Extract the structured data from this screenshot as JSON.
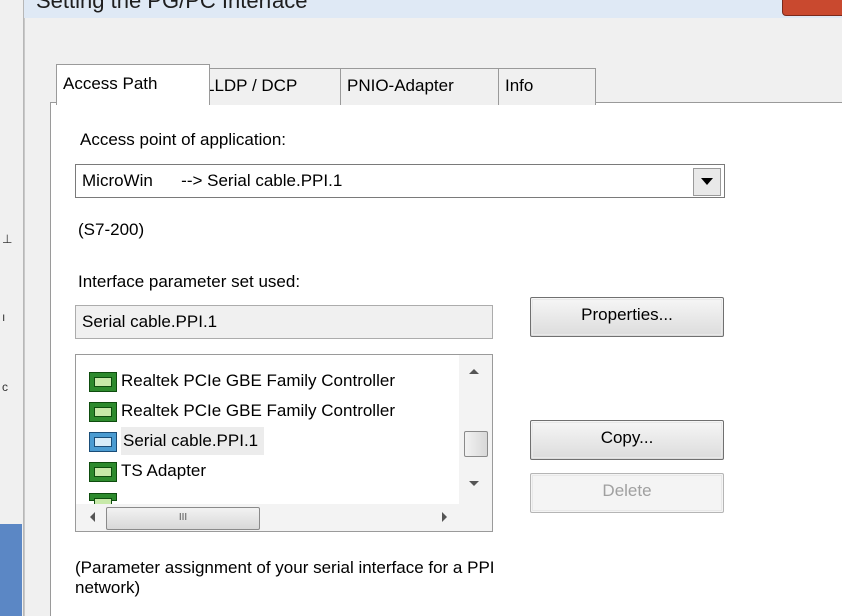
{
  "window": {
    "title": "Setting the PG/PC Interface"
  },
  "tabs": [
    {
      "label": "Access Path",
      "active": true
    },
    {
      "label": "LLDP / DCP",
      "active": false
    },
    {
      "label": "PNIO-Adapter",
      "active": false
    },
    {
      "label": "Info",
      "active": false
    }
  ],
  "access_point": {
    "label": "Access point of application:",
    "value": "MicroWin      --> Serial cable.PPI.1",
    "sublabel": "(S7-200)"
  },
  "interface": {
    "label": "Interface parameter set used:",
    "value": "Serial cable.PPI.1",
    "items": [
      {
        "label": "Realtek PCIe GBE Family Controller",
        "icon": "network-adapter-icon"
      },
      {
        "label": "Realtek PCIe GBE Family Controller",
        "icon": "network-adapter-icon"
      },
      {
        "label": "Serial cable.PPI.1",
        "icon": "serial-cable-icon",
        "selected": true
      },
      {
        "label": "TS Adapter",
        "icon": "network-adapter-icon"
      }
    ]
  },
  "buttons": {
    "properties": "Properties...",
    "copy": "Copy...",
    "delete": "Delete"
  },
  "scroll": {
    "hthumb_glyph": "III"
  },
  "note": "(Parameter assignment of your serial interface for a PPI network)",
  "colors": {
    "dialog_bg": "#f0f0f0",
    "selection": "#ececec",
    "adapter_icon": "#2d8a2d",
    "serial_icon": "#4a9bd1",
    "close_button": "#c9492f"
  }
}
